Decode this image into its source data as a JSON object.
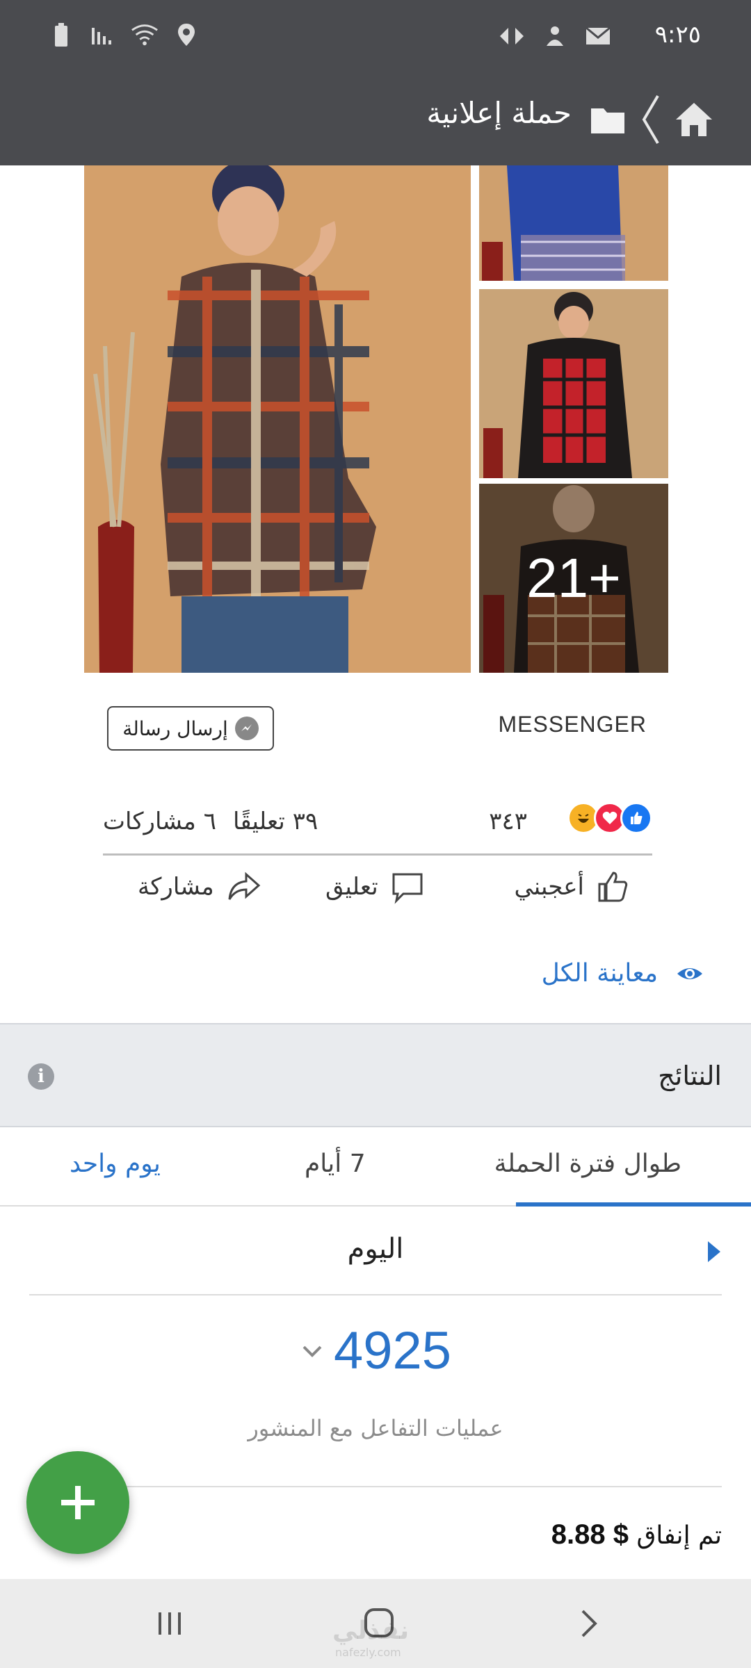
{
  "status_bar": {
    "time": "٩:٢٥"
  },
  "app_bar": {
    "title": "حملة إعلانية"
  },
  "photos": {
    "more_count": "21+"
  },
  "messenger": {
    "label": "MESSENGER",
    "send_message": "إرسال رسالة"
  },
  "reactions": {
    "count": "٣٤٣",
    "comments": "٣٩ تعليقًا",
    "shares": "٦ مشاركات"
  },
  "actions": {
    "like": "أعجبني",
    "comment": "تعليق",
    "share": "مشاركة"
  },
  "preview_all": "معاينة الكل",
  "results": {
    "title": "النتائج",
    "tabs": [
      "طوال فترة الحملة",
      "7 أيام",
      "يوم واحد"
    ],
    "active_tab": "طوال فترة الحملة",
    "day": "اليوم",
    "metric_value": "4925",
    "metric_label": "عمليات  التفاعل مع المنشور",
    "spent_label": "تم إنفاق",
    "spent_value": "$ 8.88"
  },
  "watermark": {
    "text": "نفذلي",
    "sub": "nafezly.com"
  },
  "colors": {
    "accent": "#2a73c9",
    "topbar": "#4a4b4f",
    "fab": "#43a047",
    "results_bg": "#e9ebee"
  }
}
